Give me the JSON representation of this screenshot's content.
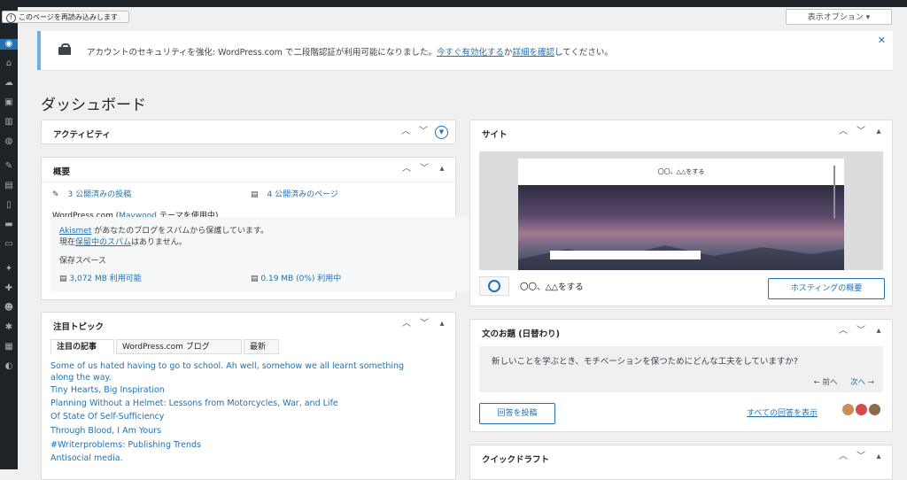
{
  "tooltip": {
    "text": "このページを再読み込みします"
  },
  "screen_options": {
    "label": "表示オプション ▾"
  },
  "notice": {
    "prefix": "アカウントのセキュリティを強化: WordPress.com で二段階認証が利用可能になりました。",
    "link1": "今すぐ有効化する",
    "mid": "か",
    "link2": "詳細を確認",
    "suffix": "してください。",
    "close": "✕"
  },
  "page_title": "ダッシュボード",
  "activity": {
    "title": "アクティビティ"
  },
  "overview": {
    "title": "概要",
    "posts": "3 公開済みの投稿",
    "pages": "4 公開済みのページ",
    "theme_prefix": "WordPress.com (",
    "theme_link": "Maywood",
    "theme_suffix": " テーマを使用中)",
    "akismet_link": "Akismet",
    "akismet_text": " があなたのブログをスパムから保護しています。",
    "spam_prefix": "現在",
    "spam_link": "保留中のスパム",
    "spam_suffix": "はありません。",
    "storage_title": "保存スペース",
    "storage_available": "3,072 MB 利用可能",
    "storage_used": "0.19 MB (0%) 利用中"
  },
  "topics": {
    "title": "注目トピック",
    "tabs": [
      "注目の記事",
      "WordPress.com ブログ",
      "最新"
    ],
    "articles": [
      "Some of us hated having to go to school. Ah well, somehow we all learnt something",
      "along the way.",
      "Tiny Hearts, Big Inspiration",
      "Planning Without a Helmet: Lessons from Motorcycles, War, and Life",
      "Of State Of Self-Sufficiency",
      "Through Blood, I Am Yours",
      "#Writerproblems: Publishing Trends",
      "Antisocial media."
    ]
  },
  "site": {
    "title": "サイト",
    "preview_title": "〇〇、△△をする",
    "name": "〇〇、△△をする",
    "hosting_button": "ホスティングの概要"
  },
  "prompt": {
    "title": "文のお題 (日替わり)",
    "question": "新しいことを学ぶとき、モチベーションを保つためにどんな工夫をしていますか?",
    "prev": "← 前へ",
    "next": "次へ →",
    "post_button": "回答を投稿",
    "all_answers": "すべての回答を表示"
  },
  "quickdraft": {
    "title": "クイックドラフト"
  },
  "colors": {
    "accent": "#2271b1",
    "sidebar": "#1d2327",
    "notice_border": "#72aee6"
  }
}
